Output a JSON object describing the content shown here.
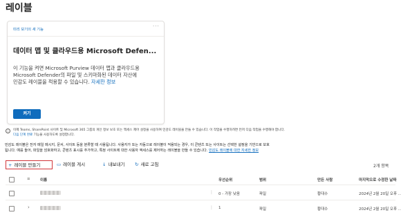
{
  "page": {
    "title": "레이블"
  },
  "card": {
    "eyebrow": "미리 보기의 새 기능",
    "more": "···",
    "title": "데이터 맵 및 클라우드용 Microsoft Defen...",
    "body_line1": "이 기능을 켜면 Microsoft Purview 데이터 맵과 클라우드용",
    "body_line2": "Microsoft Defender의 파일 및 스키마화된 데이터 자산에",
    "body_line3": "민감도 레이블을 적용할 수 있습니다.",
    "body_link": "자세한 정보",
    "button": "켜기"
  },
  "notice": {
    "line1": "이제 Teams, SharePoint 사이트 및 Microsoft 365 그룹의 개인 정보 보호 또는 액세스 제어 설정을 사용하여 민감도 레이블을 만들 수 있습니다. 이 작업을 수행하려면 먼저 다음 작업을 수행해야 합니다.",
    "line2_link": "다음 단계 완료",
    "line2_rest": "기능을 사용하도록 설정합니다."
  },
  "description": {
    "line1": "민감도 레이블은 전자 메일 메시지, 문서, 사이트 등을 분류할 때 사용됩니다. 사용자가 또는 자동으로 레이블이 적용되는 경우, 이 콘텐츠 또는 사이트는 선택한 설정을 기반으로 보호",
    "line2": "됩니다. 예를 들어, 파일을 암호화하고, 콘텐츠 표시를 추가하고, 특정 사이트에 대한 사용자 액세스를 제어하는 레이블을 만들 수 있습니다.",
    "link": "민감도 레이블에 대한 자세한 정보"
  },
  "toolbar": {
    "create": "레이블 만들기",
    "publish": "레이블 게시",
    "export": "내보내기",
    "refresh": "새로 고침",
    "item_count": "2개 항목"
  },
  "table": {
    "columns": {
      "name": "이름",
      "priority": "우선순위",
      "scope": "범위",
      "created_by": "만든 사람",
      "modified": "마지막으로 수정한 날짜"
    },
    "rows": [
      {
        "priority": "0 - 가장 낮음",
        "scope": "파일",
        "created_by": "황대수",
        "modified": "2024년 2월 20일 오후 ..."
      },
      {
        "priority": "1",
        "scope": "파일",
        "created_by": "황대수",
        "modified": "2024년 2월 20일 오후 ..."
      }
    ]
  },
  "colors": {
    "accent": "#0f6cbd",
    "highlight_border": "#d13438"
  }
}
